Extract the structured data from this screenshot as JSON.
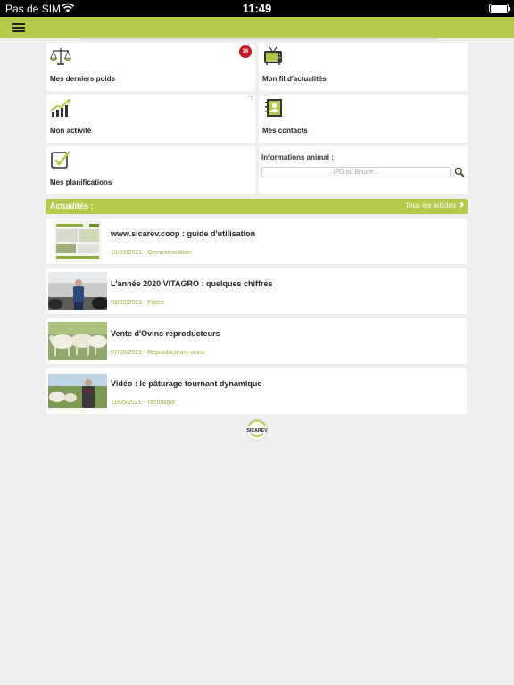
{
  "status_bar": {
    "carrier": "Pas de SIM",
    "time": "11:49"
  },
  "navbar": {
    "menu_icon": "hamburger-menu-icon",
    "accent_color": "#b5c94b"
  },
  "tiles": {
    "poids": {
      "label": "Mes derniers poids",
      "icon": "scale-icon",
      "badge": "36",
      "badge_color": "#c01920"
    },
    "actualites": {
      "label": "Mon fil d'actualités",
      "icon": "tv-icon"
    },
    "activite": {
      "label": "Mon activité",
      "icon": "growth-chart-icon"
    },
    "contacts": {
      "label": "Mes contacts",
      "icon": "contact-book-icon"
    },
    "planifications": {
      "label": "Mes planifications",
      "icon": "checkbox-icon"
    }
  },
  "animal_info": {
    "title": "Informations animal :",
    "placeholder": "IPG ou Boucle...",
    "search_icon": "magnifier-icon"
  },
  "news": {
    "header": "Actualités :",
    "all_articles": "Tous les articles",
    "articles": [
      {
        "title": "www.sicarev.coop : guide d'utilisation",
        "meta": "13/01/2021 - Communication"
      },
      {
        "title": "L'année 2020 VITAGRO : quelques chiffres",
        "meta": "02/02/2021 - Filière"
      },
      {
        "title": "Vente d'Ovins reproducteurs",
        "meta": "07/05/2021 - Reproducteurs ovins"
      },
      {
        "title": "Vidéo : le pâturage tournant dynamique",
        "meta": "11/05/2021 - Technique"
      }
    ]
  },
  "footer": {
    "logo_text": "SICAREV"
  }
}
